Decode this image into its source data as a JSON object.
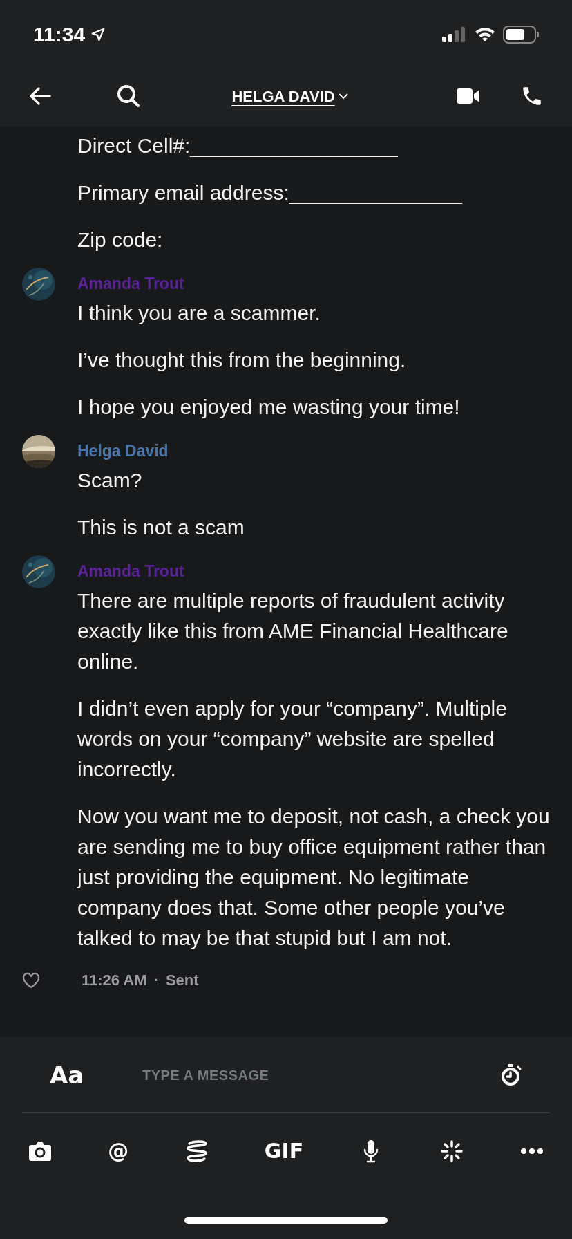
{
  "status_bar": {
    "time": "11:34"
  },
  "header": {
    "title": "HELGA DAVID"
  },
  "groups": [
    {
      "messages": [
        "Direct Cell#:__________________",
        "Primary email address:_______________",
        "Zip code:"
      ]
    },
    {
      "sender": "Amanda Trout",
      "color": "#5a2199",
      "avatar": {
        "kind": "picture"
      },
      "messages": [
        "I think you are a scammer.",
        "I’ve thought this from the beginning.",
        "I hope you enjoyed me wasting your time!"
      ]
    },
    {
      "sender": "Helga David",
      "color": "#4577ab",
      "avatar": {
        "kind": "picture"
      },
      "messages": [
        "Scam?",
        "This is not a scam"
      ]
    },
    {
      "sender": "Amanda Trout",
      "color": "#5a2199",
      "avatar": {
        "kind": "picture"
      },
      "messages": [
        "There are multiple reports of fraudulent activity exactly like this from AME Financial Healthcare online.",
        "I didn’t even apply for your “company”. Multiple words on your “company” website are spelled incorrectly.",
        "Now you want me to deposit, not cash, a check you are sending me to buy office equipment rather than just providing the equipment. No legitimate company does that. Some other people you’ve talked to may be that stupid but I am not."
      ]
    }
  ],
  "footer": {
    "liked": false,
    "time": "11:26 AM",
    "separator": "·",
    "state": "Sent"
  },
  "composer": {
    "format_label": "Aa",
    "placeholder": "TYPE A MESSAGE"
  },
  "tools": [
    {
      "kind": "camera"
    },
    {
      "kind": "text",
      "label": "@"
    },
    {
      "kind": "spiral"
    },
    {
      "kind": "text",
      "label": "GIF"
    },
    {
      "kind": "mic"
    },
    {
      "kind": "sparkle"
    },
    {
      "kind": "more"
    }
  ]
}
